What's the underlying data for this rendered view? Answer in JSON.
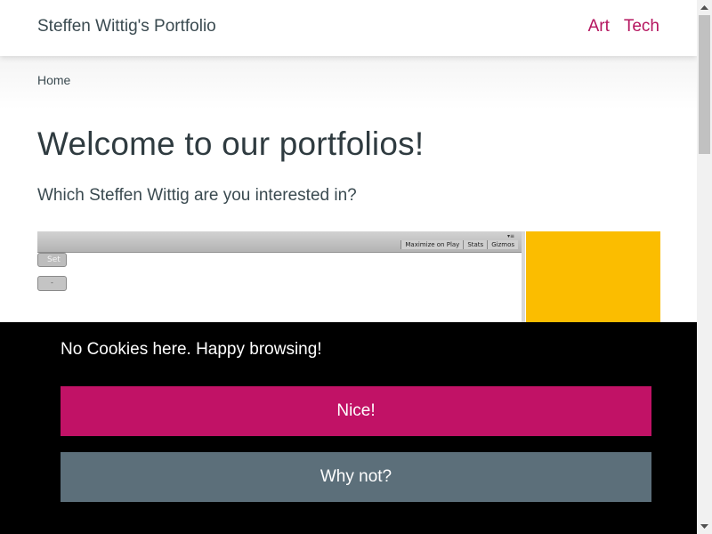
{
  "navbar": {
    "brand": "Steffen Wittig's Portfolio",
    "links": [
      {
        "label": "Art"
      },
      {
        "label": "Tech"
      }
    ],
    "link_color": "#b5155f"
  },
  "breadcrumb": {
    "home": "Home"
  },
  "main": {
    "title": "Welcome to our portfolios!",
    "subtitle": "Which Steffen Wittig are you interested in?"
  },
  "thumbnails": {
    "unity": {
      "tabs": [
        "Maximize on Play",
        "Stats",
        "Gizmos"
      ],
      "set_button": "Set",
      "small_button": "-"
    },
    "yellow_color": "#fbbd00"
  },
  "cookie_banner": {
    "message": "No Cookies here. Happy browsing!",
    "accept_label": "Nice!",
    "decline_label": "Why not?",
    "accept_color": "#c11266",
    "decline_color": "#5c6f7a"
  },
  "scrollbar": {
    "up_icon": "arrow-up-icon",
    "down_icon": "arrow-down-icon"
  }
}
